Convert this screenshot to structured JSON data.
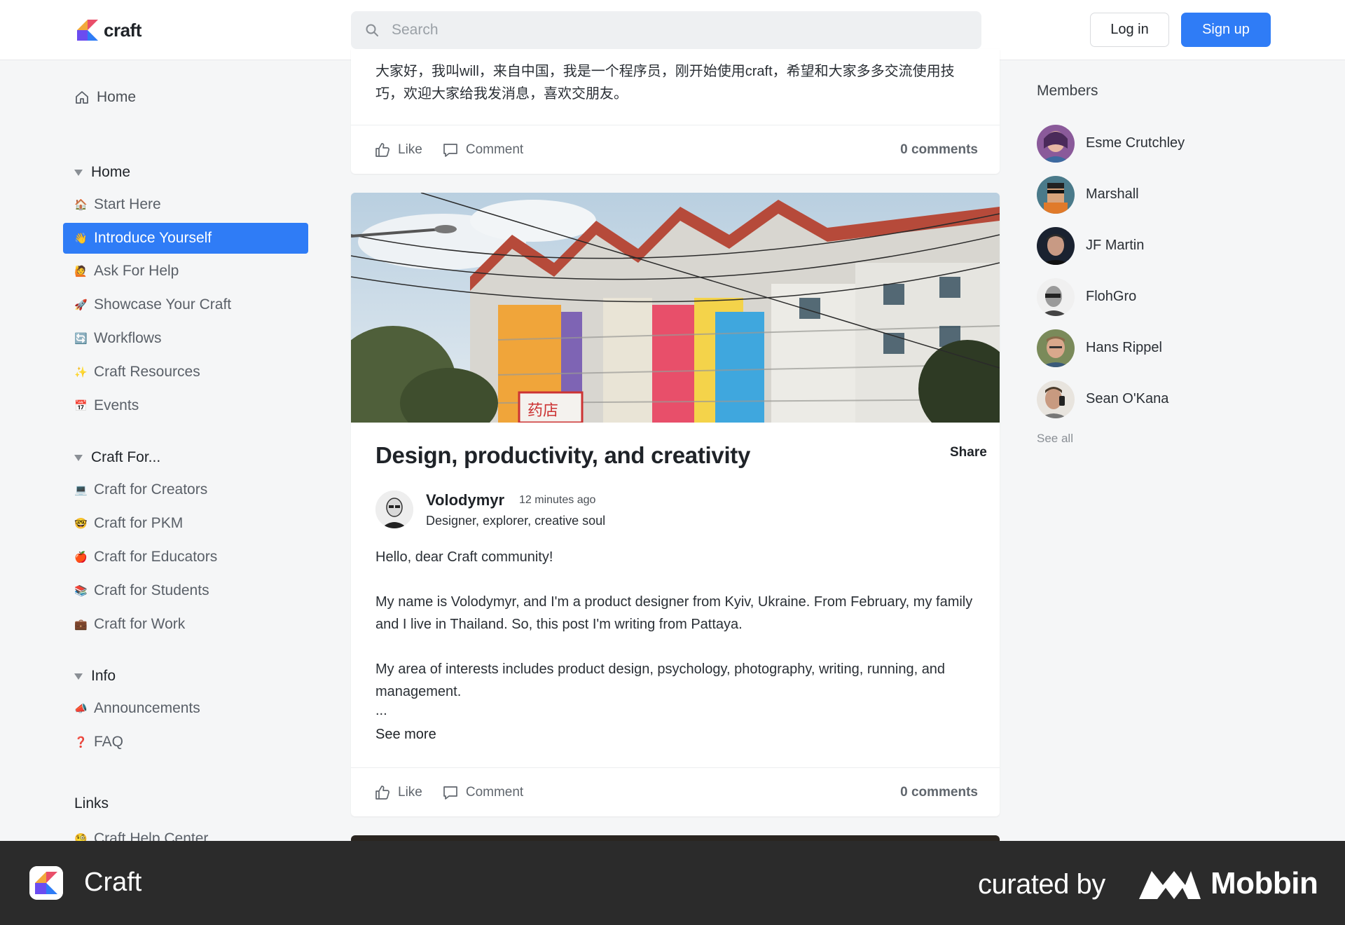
{
  "header": {
    "logo_text": "craft",
    "search_placeholder": "Search",
    "login_label": "Log in",
    "signup_label": "Sign up"
  },
  "sidebar": {
    "home": "Home",
    "sections": [
      {
        "title": "Home",
        "items": [
          {
            "emoji": "🏠",
            "label": "Start Here"
          },
          {
            "emoji": "👋",
            "label": "Introduce Yourself",
            "active": true
          },
          {
            "emoji": "🙋",
            "label": "Ask For Help"
          },
          {
            "emoji": "🚀",
            "label": "Showcase Your Craft"
          },
          {
            "emoji": "🔄",
            "label": "Workflows"
          },
          {
            "emoji": "✨",
            "label": "Craft Resources"
          },
          {
            "emoji": "📅",
            "label": "Events"
          }
        ]
      },
      {
        "title": "Craft For...",
        "items": [
          {
            "emoji": "💻",
            "label": "Craft for Creators"
          },
          {
            "emoji": "🤓",
            "label": "Craft for PKM"
          },
          {
            "emoji": "🍎",
            "label": "Craft for Educators"
          },
          {
            "emoji": "📚",
            "label": "Craft for Students"
          },
          {
            "emoji": "💼",
            "label": "Craft for Work"
          }
        ]
      },
      {
        "title": "Info",
        "items": [
          {
            "emoji": "📣",
            "label": "Announcements"
          },
          {
            "emoji": "❓",
            "label": "FAQ"
          }
        ]
      }
    ],
    "links_title": "Links",
    "links_first": {
      "emoji": "🧐",
      "label": "Craft Help Center"
    }
  },
  "feed": {
    "top_post": {
      "text": "大家好，我叫will，来自中国，我是一个程序员，刚开始使用craft，希望和大家多多交流使用技巧，欢迎大家给我发消息，喜欢交朋友。",
      "like": "Like",
      "comment": "Comment",
      "comments_count": "0 comments"
    },
    "post": {
      "title": "Design, productivity, and creativity",
      "share": "Share",
      "author": "Volodymyr",
      "time": "12 minutes ago",
      "bio": "Designer, explorer, creative soul",
      "p1": "Hello, dear Craft community!",
      "p2": "My name is Volodymyr, and I'm a product designer from Kyiv, Ukraine. From February, my family and I live in Thailand. So, this post I'm writing from Pattaya.",
      "p3": "My area of interests includes product design, psychology, photography, writing, running, and management.",
      "ellipsis": "...",
      "see_more": "See more",
      "like": "Like",
      "comment": "Comment",
      "comments_count": "0 comments",
      "image_sign": "药店"
    }
  },
  "members": {
    "title": "Members",
    "list": [
      "Esme Crutchley",
      "Marshall",
      "JF Martin",
      "FlohGro",
      "Hans Rippel",
      "Sean O'Kana"
    ],
    "see_all": "See all"
  },
  "footer": {
    "app_name": "Craft",
    "curated_by": "curated by",
    "brand": "Mobbin"
  },
  "colors": {
    "accent": "#2f7cf6",
    "footer_bg": "#2b2b2b"
  }
}
